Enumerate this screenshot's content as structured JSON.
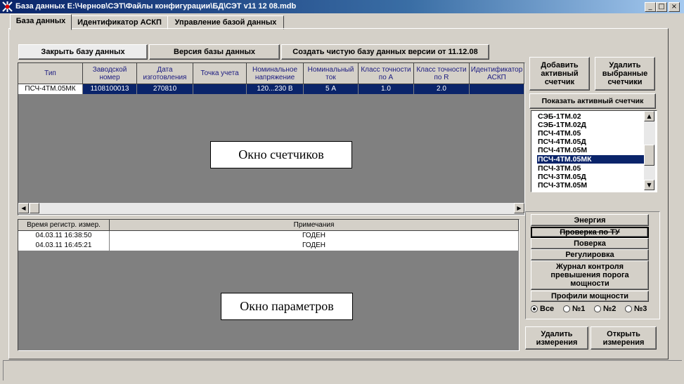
{
  "window": {
    "title": "База данных E:\\Чернов\\СЭТ\\Файлы конфигурации\\БД\\СЭТ v11 12 08.mdb"
  },
  "tabs": [
    {
      "label": "База данных"
    },
    {
      "label": "Идентификатор АСКП"
    },
    {
      "label": "Управление базой данных"
    }
  ],
  "toolbar": {
    "close_db": "Закрыть базу данных",
    "db_version": "Версия базы данных",
    "create_clean": "Создать чистую базу данных версии от 11.12.08"
  },
  "meters_table": {
    "columns": [
      "Тип",
      "Заводской номер",
      "Дата изготовления",
      "Точка учета",
      "Номинальное напряжение",
      "Номинальный ток",
      "Класс точности по A",
      "Класс точности по R",
      "Идентификатор АСКП"
    ],
    "rows": [
      [
        "ПСЧ-4ТМ.05МК",
        "1108100013",
        "270810",
        "",
        "120...230 В",
        "5 А",
        "1.0",
        "2.0",
        ""
      ]
    ]
  },
  "measurements_table": {
    "columns": [
      "Время регистр. измер.",
      "Примечания"
    ],
    "rows": [
      [
        "04.03.11 16:38:50",
        "ГОДЕН"
      ],
      [
        "04.03.11 16:45:21",
        "ГОДЕН"
      ]
    ]
  },
  "overlays": {
    "meters": "Окно счетчиков",
    "params": "Окно параметров"
  },
  "right_panel": {
    "add_active": "Добавить активный счетчик",
    "delete_selected": "Удалить выбранные счетчики",
    "show_active": "Показать активный счетчик",
    "meter_types": [
      "СЭБ-1ТМ.02",
      "СЭБ-1ТМ.02Д",
      "ПСЧ-4ТМ.05",
      "ПСЧ-4ТМ.05Д",
      "ПСЧ-4ТМ.05М",
      "ПСЧ-4ТМ.05МК",
      "ПСЧ-3ТМ.05",
      "ПСЧ-3ТМ.05Д",
      "ПСЧ-3ТМ.05М"
    ],
    "selected_meter_type": "ПСЧ-4ТМ.05МК",
    "param_buttons": [
      "Энергия",
      "Проверка по ТУ",
      "Поверка",
      "Регулировка",
      "Журнал контроля превышения порога мощности",
      "Профили мощности"
    ],
    "radio": {
      "options": [
        "Все",
        "№1",
        "№2",
        "№3"
      ],
      "selected": "Все"
    },
    "delete_measurements": "Удалить измерения",
    "open_measurements": "Открыть измерения"
  },
  "colors": {
    "selection": "#0a246a",
    "face": "#d4d0c8",
    "grid_bg": "#808080"
  },
  "icons": {
    "app": "app-logo-icon",
    "minimize": "minimize-icon",
    "maximize": "maximize-icon",
    "close": "close-icon"
  }
}
